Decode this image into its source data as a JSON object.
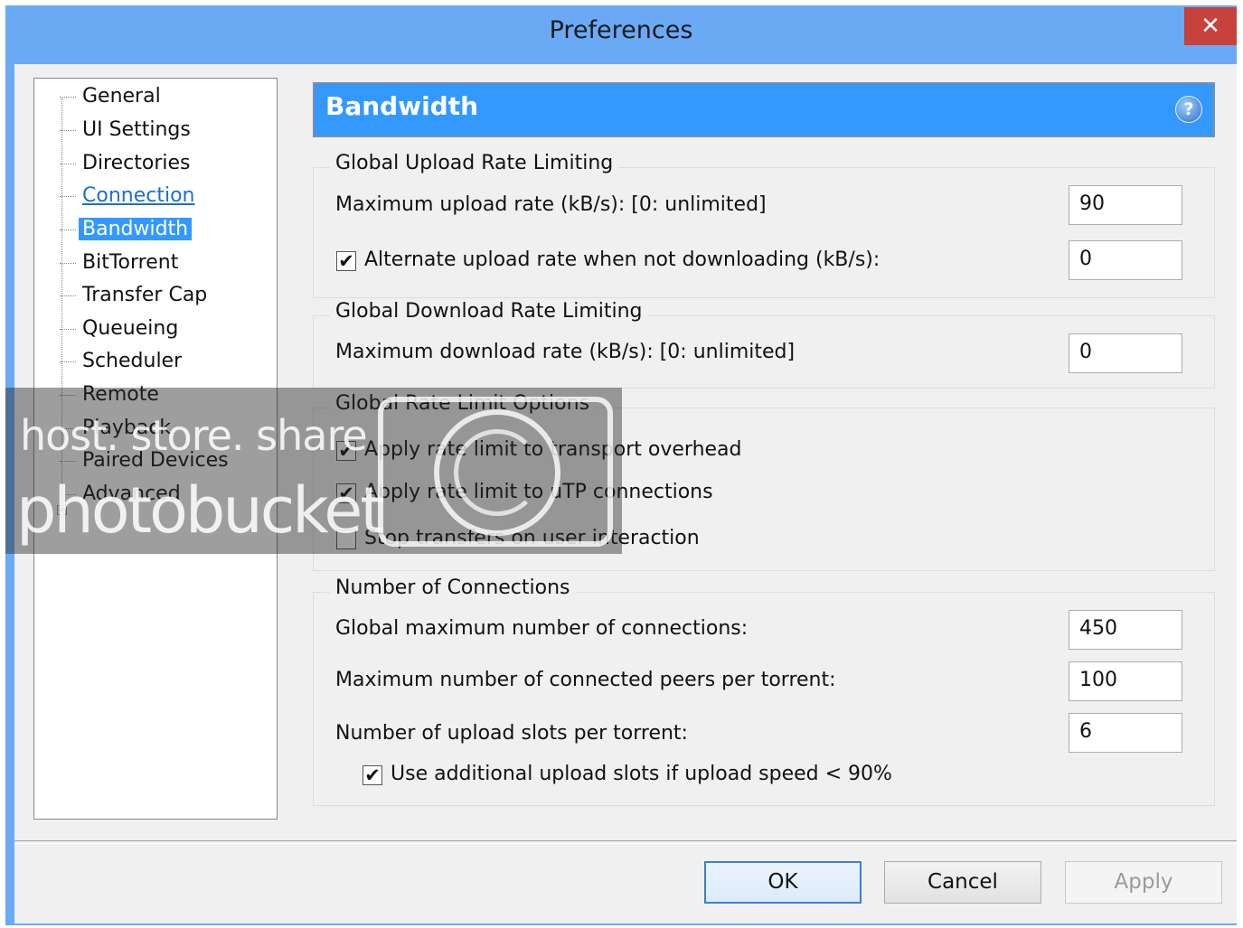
{
  "window": {
    "title": "Preferences",
    "close_label": "✕"
  },
  "tree": {
    "items": [
      {
        "label": "General"
      },
      {
        "label": "UI Settings"
      },
      {
        "label": "Directories"
      },
      {
        "label": "Connection"
      },
      {
        "label": "Bandwidth"
      },
      {
        "label": "BitTorrent"
      },
      {
        "label": "Transfer Cap"
      },
      {
        "label": "Queueing"
      },
      {
        "label": "Scheduler"
      },
      {
        "label": "Remote"
      },
      {
        "label": "Playback"
      },
      {
        "label": "Paired Devices"
      },
      {
        "label": "Advanced"
      }
    ],
    "expander": "+"
  },
  "header": {
    "title": "Bandwidth",
    "help": "?"
  },
  "upload": {
    "group_title": "Global Upload Rate Limiting",
    "max_label": "Maximum upload rate (kB/s): [0: unlimited]",
    "max_value": "90",
    "alt_label": "Alternate upload rate when not downloading (kB/s):",
    "alt_checked": "✔",
    "alt_value": "0"
  },
  "download": {
    "group_title": "Global Download Rate Limiting",
    "max_label": "Maximum download rate (kB/s): [0: unlimited]",
    "max_value": "0"
  },
  "options": {
    "group_title": "Global Rate Limit Options",
    "transport_label": "Apply rate limit to transport overhead",
    "transport_checked": "✔",
    "utp_label": "Apply rate limit to uTP connections",
    "utp_checked": "✔",
    "stop_label": "Stop transfers on user interaction",
    "stop_checked": ""
  },
  "connections": {
    "group_title": "Number of Connections",
    "global_label": "Global maximum number of connections:",
    "global_value": "450",
    "peers_label": "Maximum number of connected peers per torrent:",
    "peers_value": "100",
    "slots_label": "Number of upload slots per torrent:",
    "slots_value": "6",
    "additional_label": "Use additional upload slots if upload speed < 90%",
    "additional_checked": "✔"
  },
  "buttons": {
    "ok": "OK",
    "cancel": "Cancel",
    "apply": "Apply"
  },
  "watermark": {
    "line1": "host. store. share",
    "line2": "photobucket"
  }
}
